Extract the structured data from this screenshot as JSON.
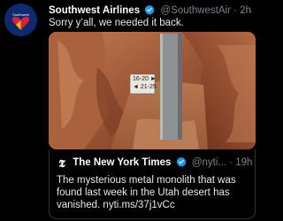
{
  "tweet": {
    "author_name": "Southwest Airlines",
    "handle": "@SouthwestAir",
    "separator": "·",
    "time": "2h",
    "more_label": "···",
    "text": "Sorry y’all, we needed it back.",
    "avatar_icon": "southwest-heart-logo",
    "verified_icon": "verified-badge-icon",
    "accent_color": "#1d9bf0"
  },
  "media": {
    "sign_line1": "16-20 ►",
    "sign_line2": "◄ 21-25"
  },
  "quote": {
    "logo_glyph": "𝕿",
    "author_name": "The New York Times",
    "handle": "@nyti...",
    "separator": "·",
    "time": "19h",
    "text": "The mysterious metal monolith that was found last week in the Utah desert has vanished. nyti.ms/37j1vCc"
  }
}
